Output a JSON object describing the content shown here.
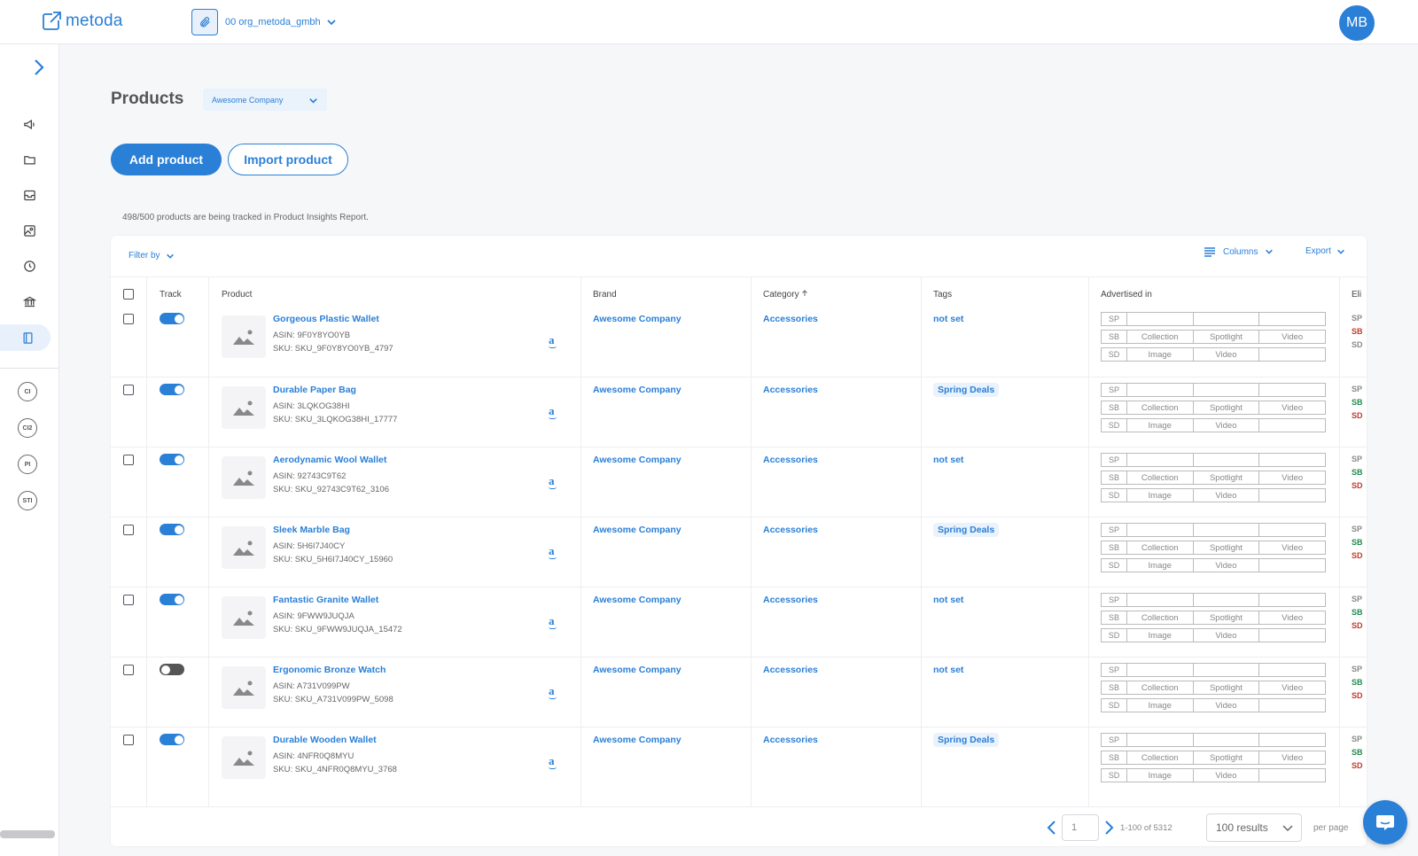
{
  "app": {
    "logo_text": "metoda",
    "logo_icon": "external-link-icon"
  },
  "org": {
    "name": "00 org_metoda_gmbh",
    "icon": "paperclip-icon"
  },
  "user": {
    "initials": "MB"
  },
  "sidebar": {
    "nav": [
      {
        "name": "megaphone-icon"
      },
      {
        "name": "folder-icon"
      },
      {
        "name": "inbox-icon"
      },
      {
        "name": "image-gallery-icon"
      },
      {
        "name": "clock-icon"
      },
      {
        "name": "bank-icon"
      },
      {
        "name": "book-icon"
      }
    ],
    "badges": [
      "CI",
      "CI2",
      "PI",
      "STI"
    ]
  },
  "page": {
    "title": "Products",
    "company": "Awesome Company",
    "add_button": "Add product",
    "import_button": "Import product",
    "tracked_note": "498/500 products are being tracked in Product Insights Report."
  },
  "toolbar": {
    "filter": "Filter by",
    "columns": "Columns",
    "export": "Export"
  },
  "table": {
    "headers": {
      "track": "Track",
      "product": "Product",
      "brand": "Brand",
      "category": "Category",
      "tags": "Tags",
      "advertised": "Advertised in",
      "eligible": "Eli"
    },
    "adv_labels": {
      "sp": "SP",
      "sb": "SB",
      "sd": "SD",
      "collection": "Collection",
      "spotlight": "Spotlight",
      "video": "Video",
      "image": "Image"
    },
    "rows": [
      {
        "name": "Gorgeous Plastic Wallet",
        "asin": "ASIN: 9F0Y8YO0YB",
        "sku": "SKU: SKU_9F0Y8YO0YB_4797",
        "brand": "Awesome Company",
        "category": "Accessories",
        "tag": "not set",
        "tracked": true,
        "elig_colors": [
          "#888",
          "#c0392b",
          "#888"
        ]
      },
      {
        "name": "Durable Paper Bag",
        "asin": "ASIN: 3LQKOG38HI",
        "sku": "SKU: SKU_3LQKOG38HI_17777",
        "brand": "Awesome Company",
        "category": "Accessories",
        "tag": "Spring Deals",
        "tracked": true,
        "elig_colors": [
          "#888",
          "#1e8a4c",
          "#c0392b"
        ]
      },
      {
        "name": "Aerodynamic Wool Wallet",
        "asin": "ASIN: 92743C9T62",
        "sku": "SKU: SKU_92743C9T62_3106",
        "brand": "Awesome Company",
        "category": "Accessories",
        "tag": "not set",
        "tracked": true,
        "elig_colors": [
          "#888",
          "#1e8a4c",
          "#c0392b"
        ]
      },
      {
        "name": "Sleek Marble Bag",
        "asin": "ASIN: 5H6I7J40CY",
        "sku": "SKU: SKU_5H6I7J40CY_15960",
        "brand": "Awesome Company",
        "category": "Accessories",
        "tag": "Spring Deals",
        "tracked": true,
        "elig_colors": [
          "#888",
          "#1e8a4c",
          "#c0392b"
        ]
      },
      {
        "name": "Fantastic Granite Wallet",
        "asin": "ASIN: 9FWW9JUQJA",
        "sku": "SKU: SKU_9FWW9JUQJA_15472",
        "brand": "Awesome Company",
        "category": "Accessories",
        "tag": "not set",
        "tracked": true,
        "elig_colors": [
          "#888",
          "#1e8a4c",
          "#c0392b"
        ]
      },
      {
        "name": "Ergonomic Bronze Watch",
        "asin": "ASIN: A731V099PW",
        "sku": "SKU: SKU_A731V099PW_5098",
        "brand": "Awesome Company",
        "category": "Accessories",
        "tag": "not set",
        "tracked": false,
        "elig_colors": [
          "#888",
          "#1e8a4c",
          "#c0392b"
        ]
      },
      {
        "name": "Durable Wooden Wallet",
        "asin": "ASIN: 4NFR0Q8MYU",
        "sku": "SKU: SKU_4NFR0Q8MYU_3768",
        "brand": "Awesome Company",
        "category": "Accessories",
        "tag": "Spring Deals",
        "tracked": true,
        "elig_colors": [
          "#888",
          "#1e8a4c",
          "#c0392b"
        ]
      }
    ]
  },
  "pagination": {
    "page": "1",
    "range": "1-100 of 5312",
    "size": "100 results",
    "per_page": "per page"
  },
  "colors": {
    "accent": "#2a7fd6",
    "green": "#1e8a4c",
    "red": "#c0392b"
  }
}
